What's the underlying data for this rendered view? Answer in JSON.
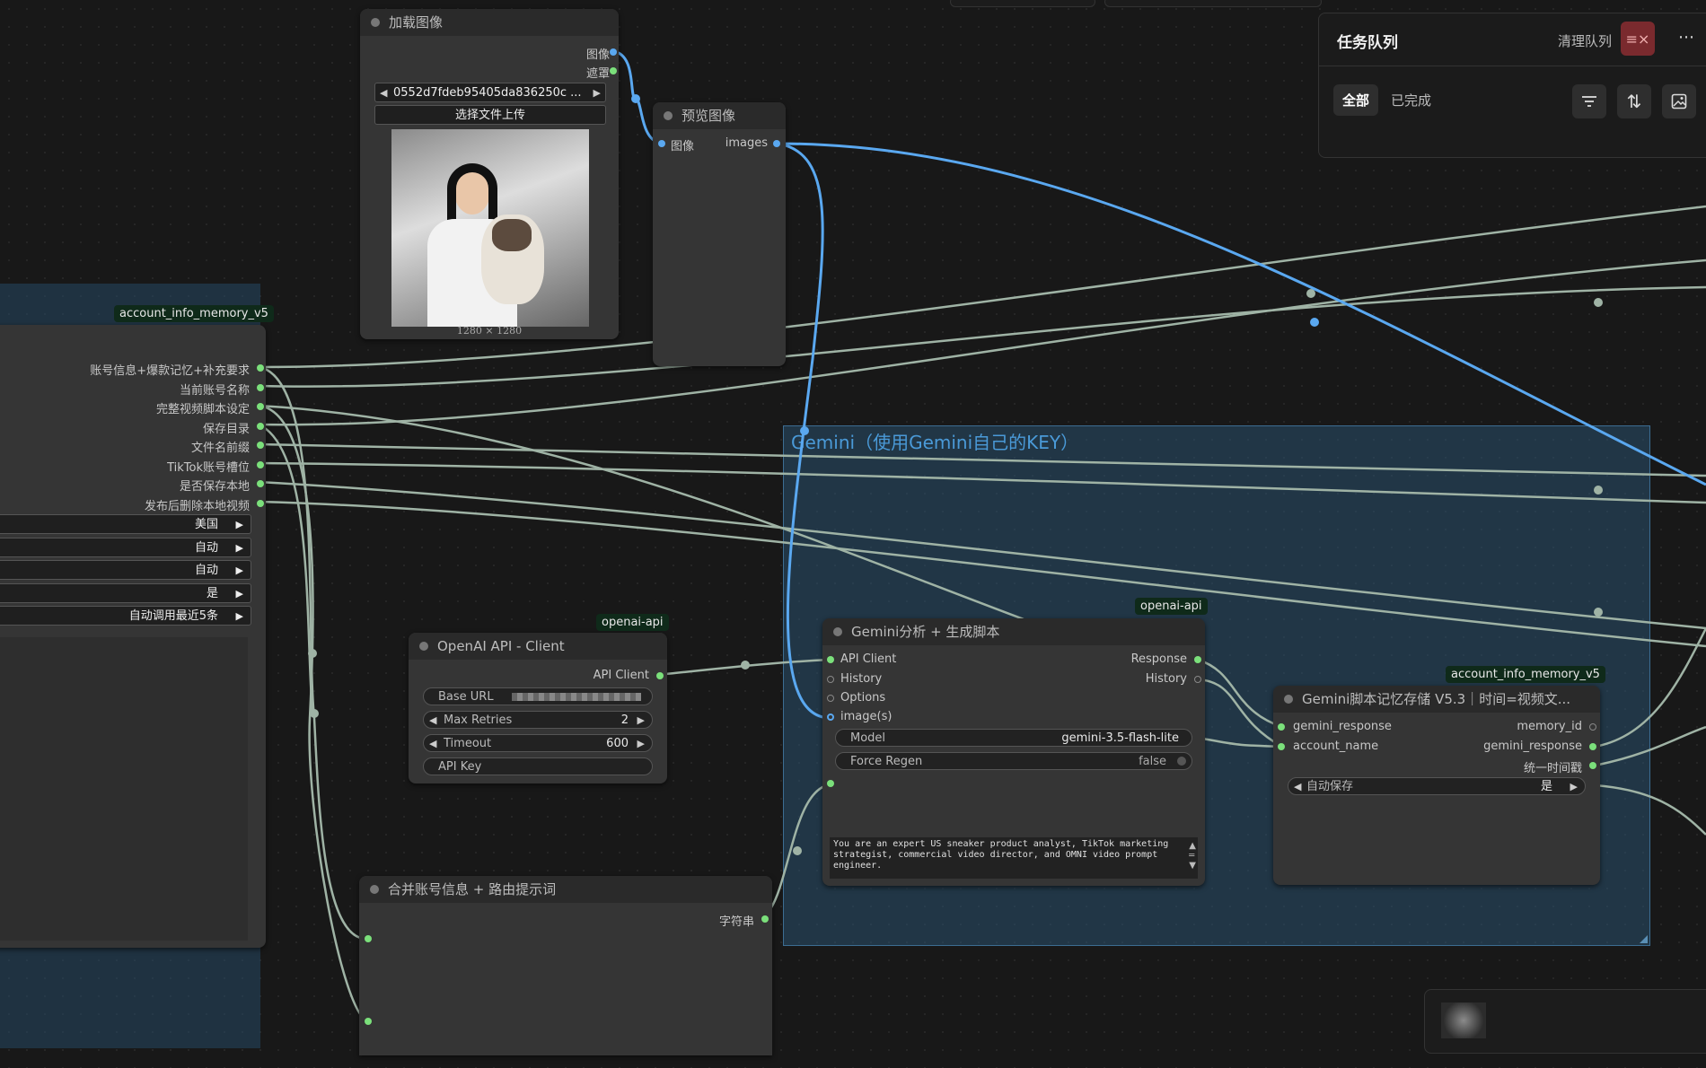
{
  "group": {
    "title": "Gemini（使用Gemini自己的KEY）"
  },
  "load_image": {
    "title": "加载图像",
    "out_image": "图像",
    "out_mask": "遮罩",
    "filename": "0552d7fdeb95405da836250c ...",
    "upload": "选择文件上传",
    "size": "1280 × 1280"
  },
  "preview_image": {
    "title": "预览图像",
    "in_image": "图像",
    "out_images": "images"
  },
  "account_node": {
    "tag": "account_info_memory_v5",
    "outputs": [
      "账号信息+爆款记忆+补充要求",
      "当前账号名称",
      "完整视频脚本设定",
      "保存目录",
      "文件名前缀",
      "TikTok账号槽位",
      "是否保存本地",
      "发布后删除本地视频"
    ],
    "widgets": [
      "美国",
      "自动",
      "自动",
      "是",
      "自动调用最近5条"
    ]
  },
  "openai_node": {
    "tag": "openai-api",
    "title": "OpenAI API - Client",
    "out": "API Client",
    "base_url_label": "Base URL",
    "max_retries_label": "Max Retries",
    "max_retries": "2",
    "timeout_label": "Timeout",
    "timeout": "600",
    "api_key_label": "API Key"
  },
  "merge_node": {
    "title": "合并账号信息 + 路由提示词",
    "out": "字符串"
  },
  "gemini_node": {
    "tag": "openai-api",
    "title": "Gemini分析 + 生成脚本",
    "in_client": "API Client",
    "in_history": "History",
    "in_options": "Options",
    "in_images": "image(s)",
    "out_response": "Response",
    "out_history": "History",
    "model_label": "Model",
    "model": "gemini-3.5-flash-lite",
    "regen_label": "Force Regen",
    "regen": "false",
    "prompt": "You are an expert US sneaker product analyst, TikTok marketing strategist, commercial video director, and OMNI video prompt engineer."
  },
  "memory_node": {
    "tag": "account_info_memory_v5",
    "title": "Gemini脚本记忆存储 V5.3｜时间=视频文...",
    "in_response": "gemini_response",
    "in_account": "account_name",
    "out_memory_id": "memory_id",
    "out_response": "gemini_response",
    "out_time": "统一时间戳",
    "autosave_label": "自动保存",
    "autosave": "是"
  },
  "queue_panel": {
    "title": "任务队列",
    "clear": "清理队列",
    "tab_all": "全部",
    "tab_done": "已完成",
    "icons": [
      "clear-queue-icon",
      "more-icon",
      "filter-icon",
      "sort-icon",
      "image-view-icon"
    ]
  },
  "colors": {
    "image_wire": "#5aa8f0",
    "wire": "#9fb3a5",
    "green_pin": "#7be07b",
    "accent_red": "#a83236"
  }
}
